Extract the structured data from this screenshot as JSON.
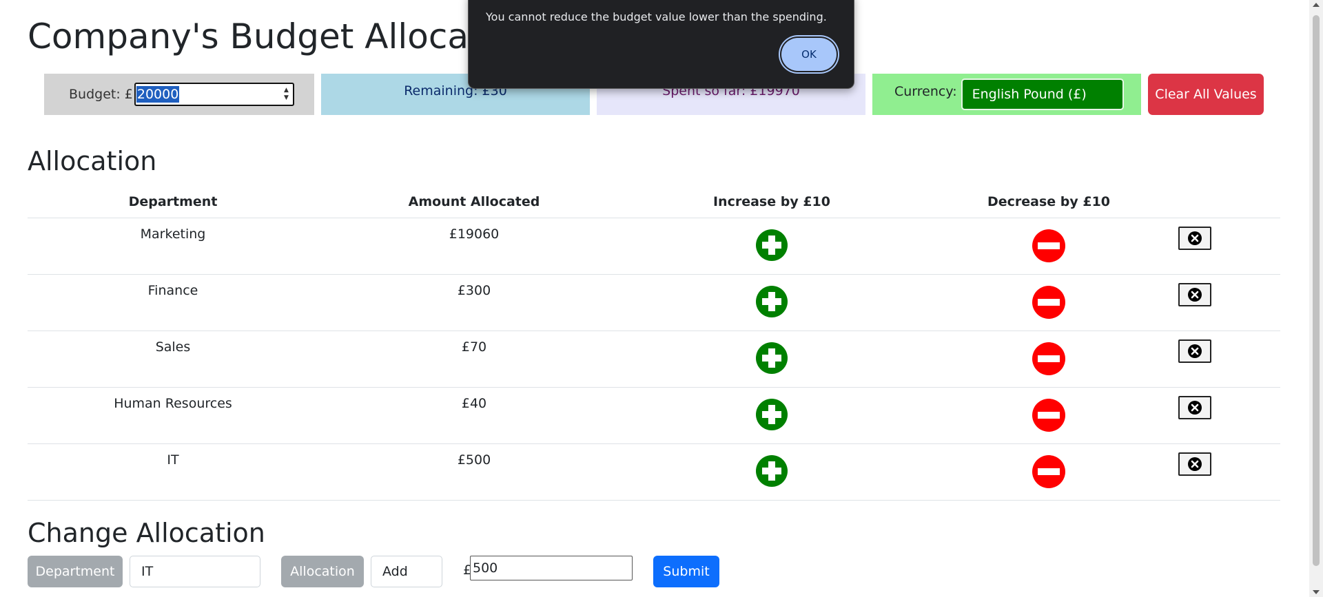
{
  "page": {
    "title": "Company's Budget Allocation"
  },
  "topbar": {
    "budget_label": "Budget: £",
    "budget_value": "20000",
    "remaining": "Remaining: £30",
    "spent": "Spent so far: £19970",
    "currency_label": "Currency:",
    "currency_selected": "English Pound (£)",
    "clear_label": "Clear All Values"
  },
  "allocation": {
    "title": "Allocation",
    "headers": [
      "Department",
      "Amount Allocated",
      "Increase by £10",
      "Decrease by £10",
      ""
    ],
    "rows": [
      {
        "department": "Marketing",
        "amount": "£19060"
      },
      {
        "department": "Finance",
        "amount": "£300"
      },
      {
        "department": "Sales",
        "amount": "£70"
      },
      {
        "department": "Human Resources",
        "amount": "£40"
      },
      {
        "department": "IT",
        "amount": "£500"
      }
    ]
  },
  "change": {
    "title": "Change Allocation",
    "department_label": "Department",
    "department_value": "IT",
    "allocation_label": "Allocation",
    "action_value": "Add",
    "currency_symbol": "£",
    "amount_value": "500",
    "submit_label": "Submit"
  },
  "alert": {
    "message": "You cannot reduce the budget value lower than the spending.",
    "ok_label": "OK"
  },
  "icons": {
    "increase": "plus-circle-icon",
    "decrease": "minus-circle-icon",
    "delete": "x-circle-icon"
  },
  "colors": {
    "increase": "#008000",
    "decrease": "#ff0000",
    "clear_button": "#dc3545",
    "submit_button": "#0d6efd",
    "currency_box": "#90ee90",
    "currency_select": "#008000",
    "remaining_box": "#add8e6",
    "spent_box": "#e6e6fa",
    "budget_box": "#d3d3d3"
  }
}
